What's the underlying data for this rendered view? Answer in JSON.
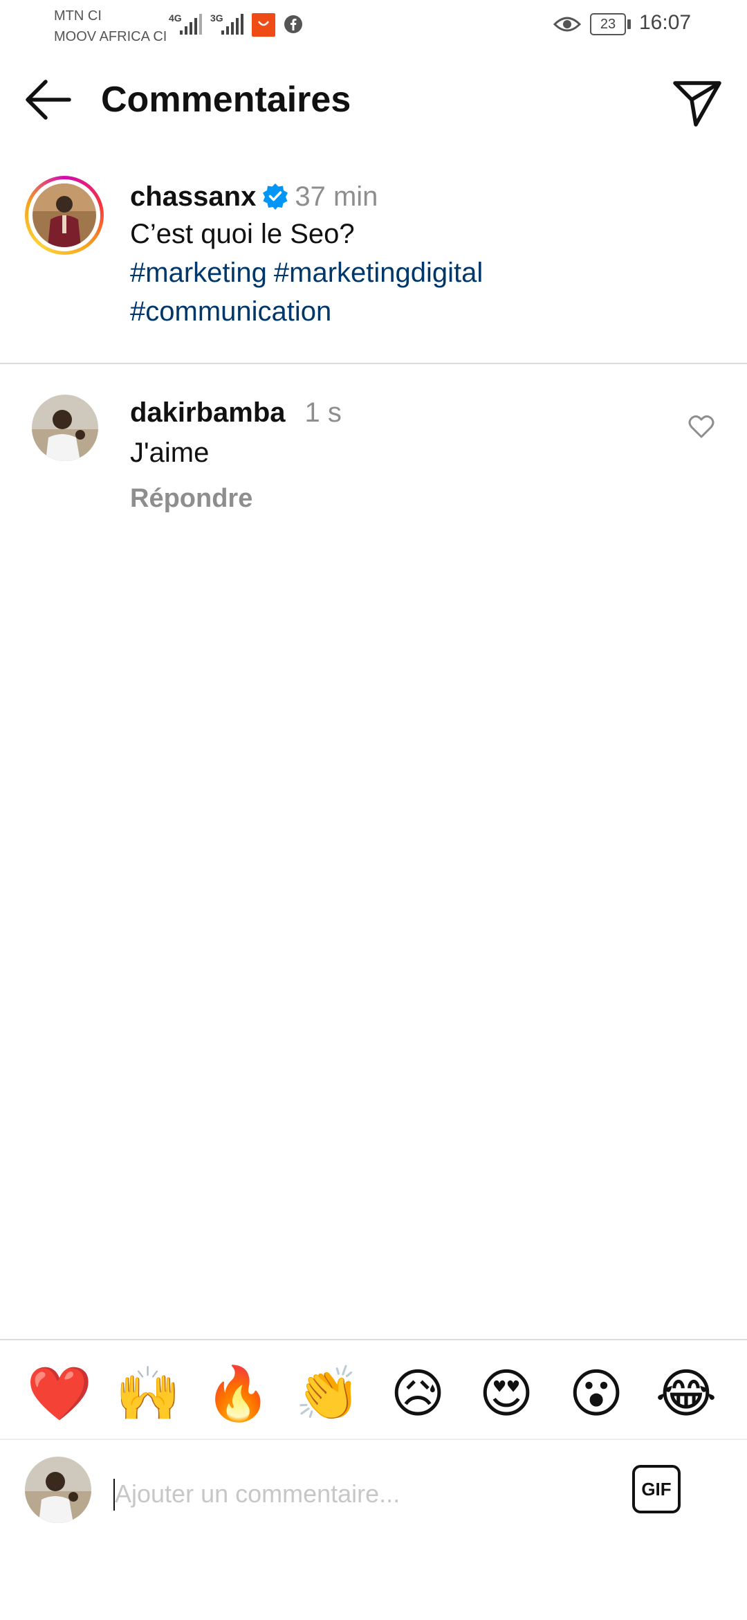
{
  "status_bar": {
    "carrier_1": "MTN CI",
    "carrier_2": "MOOV AFRICA CI",
    "net_1": "4G",
    "net_2": "3G",
    "battery": "23",
    "time": "16:07"
  },
  "header": {
    "title": "Commentaires",
    "back_icon": "arrow-left-icon",
    "send_icon": "paper-plane-icon"
  },
  "caption": {
    "username": "chassanx",
    "time": "37 min",
    "text": "C’est quoi le Seo?",
    "hashtags": [
      "#marketing",
      "#marketingdigital",
      "#communication"
    ]
  },
  "comment": {
    "username": "dakirbamba",
    "time": "1 s",
    "text": "J'aime",
    "reply_label": "Répondre"
  },
  "emoji_bar": {
    "emojis": [
      "❤️",
      "🙌",
      "🔥",
      "👏",
      "😥",
      "😍",
      "😮",
      "😂"
    ]
  },
  "composer": {
    "placeholder": "Ajouter un commentaire...",
    "gif_label": "GIF"
  },
  "colors": {
    "hashtag": "#00376b",
    "verified": "#0095f6",
    "muted": "#8e8e8e"
  }
}
